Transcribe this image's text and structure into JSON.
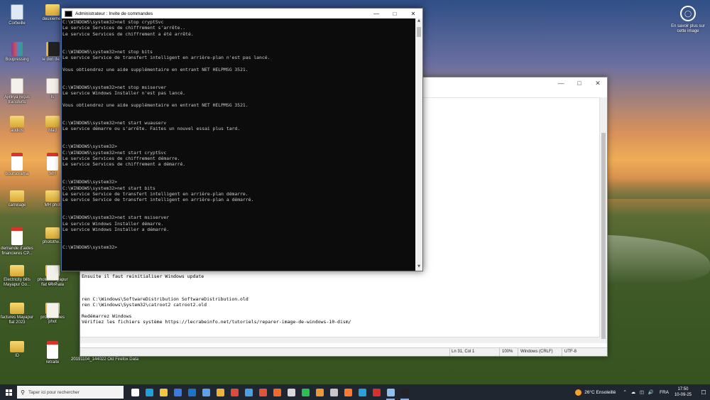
{
  "desktop": {
    "icons": [
      {
        "label": "Corbeille",
        "kind": "bin"
      },
      {
        "label": "Boupressing",
        "kind": "rar"
      },
      {
        "label": "Ajinkya reçus transferts",
        "kind": "doc"
      },
      {
        "label": "audios",
        "kind": "folder"
      },
      {
        "label": "boursorama",
        "kind": "pdf"
      },
      {
        "label": "carrelage",
        "kind": "folder"
      },
      {
        "label": "demande d'aides financieres CP...",
        "kind": "pdf"
      },
      {
        "label": "Electricity bills Mayapur Go...",
        "kind": "folder"
      },
      {
        "label": "factures Mayapur flat 2023",
        "kind": "folder"
      },
      {
        "label": "ID",
        "kind": "folder"
      },
      {
        "label": "deuxiemes",
        "kind": "folder"
      },
      {
        "label": "le don de...",
        "kind": "book"
      },
      {
        "label": "ls",
        "kind": "doc"
      },
      {
        "label": "Mad",
        "kind": "folder"
      },
      {
        "label": "MH",
        "kind": "pdf"
      },
      {
        "label": "MH phot",
        "kind": "folder"
      },
      {
        "label": "photos Mayapur flat Goshala",
        "kind": "folder"
      },
      {
        "label": "programmes",
        "kind": "folder"
      },
      {
        "label": "retraite",
        "kind": "pdf"
      },
      {
        "label": "un d",
        "kind": "doc"
      },
      {
        "label": "phot",
        "kind": "doc"
      },
      {
        "label": "photothe...",
        "kind": "folder"
      }
    ],
    "footer_label": "20191104_144022  Old Firefox Data",
    "spotlight": {
      "label": "En savoir plus sur cette image",
      "icon": "camera-icon"
    }
  },
  "cmd": {
    "title": "Administrateur : Invite de commandes",
    "lines": [
      "C:\\WINDOWS\\system32>net stop cryptSvc",
      "Le service Services de chiffrement s'arrête..",
      "Le service Services de chiffrement a été arrêté.",
      "",
      "",
      "C:\\WINDOWS\\system32>net stop bits",
      "Le service Service de transfert intelligent en arrière-plan n'est pas lancé.",
      "",
      "Vous obtiendrez une aide supplémentaire en entrant NET HELPMSG 3521.",
      "",
      "",
      "C:\\WINDOWS\\system32>net stop msiserver",
      "Le service Windows Installer n'est pas lancé.",
      "",
      "Vous obtiendrez une aide supplémentaire en entrant NET HELPMSG 3521.",
      "",
      "",
      "C:\\WINDOWS\\system32>net start wuauserv",
      "Le service démarre ou s'arrête. Faites un nouvel essai plus tard.",
      "",
      "",
      "C:\\WINDOWS\\system32>",
      "C:\\WINDOWS\\system32>net start cryptSvc",
      "Le service Services de chiffrement démarre.",
      "Le service Services de chiffrement a démarré.",
      "",
      "",
      "C:\\WINDOWS\\system32>",
      "C:\\WINDOWS\\system32>net start bits",
      "Le service Service de transfert intelligent en arrière-plan démarre.",
      "Le service Service de transfert intelligent en arrière-plan a démarré.",
      "",
      "",
      "C:\\WINDOWS\\system32>net start msiserver",
      "Le service Windows Installer démarre.",
      "Le service Windows Installer a démarré.",
      "",
      "",
      "C:\\WINDOWS\\system32>"
    ]
  },
  "notepad": {
    "lines": [
      "Ensuite il faut reinitialiser Windows update",
      "",
      "",
      "",
      "ren C:\\Windows\\SoftwareDistribution SoftwareDistribution.old",
      "ren C:\\Windows\\System32\\catroot2 catroot2.old",
      "",
      "Redémarrez Windows",
      "Vérifiez les fichiers système https://lecrabeinfo.net/tutoriels/reparer-image-de-windows-10-dism/"
    ],
    "status": {
      "position": "Ln 31, Col 1",
      "zoom": "100%",
      "line_ending": "Windows (CRLF)",
      "encoding": "UTF-8"
    }
  },
  "taskbar": {
    "search_placeholder": "Taper ici pour rechercher",
    "apps": [
      {
        "name": "task-view",
        "color": "#ffffff"
      },
      {
        "name": "edge",
        "color": "#1fa0d8"
      },
      {
        "name": "file-explorer",
        "color": "#f4c542"
      },
      {
        "name": "store",
        "color": "#3b7be0"
      },
      {
        "name": "outlook",
        "color": "#1d73c8"
      },
      {
        "name": "remote",
        "color": "#5ea3e8"
      },
      {
        "name": "chrome",
        "color": "#e8b43a"
      },
      {
        "name": "app-red",
        "color": "#e04a3a"
      },
      {
        "name": "app-blue",
        "color": "#4aa0e0"
      },
      {
        "name": "anydesk",
        "color": "#e2543a"
      },
      {
        "name": "brave",
        "color": "#f06a2a"
      },
      {
        "name": "app-white",
        "color": "#d8d8d8"
      },
      {
        "name": "whatsapp",
        "color": "#2bbf56"
      },
      {
        "name": "app-orange",
        "color": "#e89a3a"
      },
      {
        "name": "app-gray",
        "color": "#c8c8c8"
      },
      {
        "name": "firefox",
        "color": "#ff7a2e"
      },
      {
        "name": "app-teal",
        "color": "#2aa1d8"
      },
      {
        "name": "acrobat",
        "color": "#d8302a"
      },
      {
        "name": "notepad",
        "color": "#8fc2e8"
      },
      {
        "name": "cmd",
        "color": "#222222"
      }
    ],
    "weather": "26°C  Ensoleillé",
    "language": "FRA",
    "time": "17:50",
    "date": "10-09-25"
  }
}
